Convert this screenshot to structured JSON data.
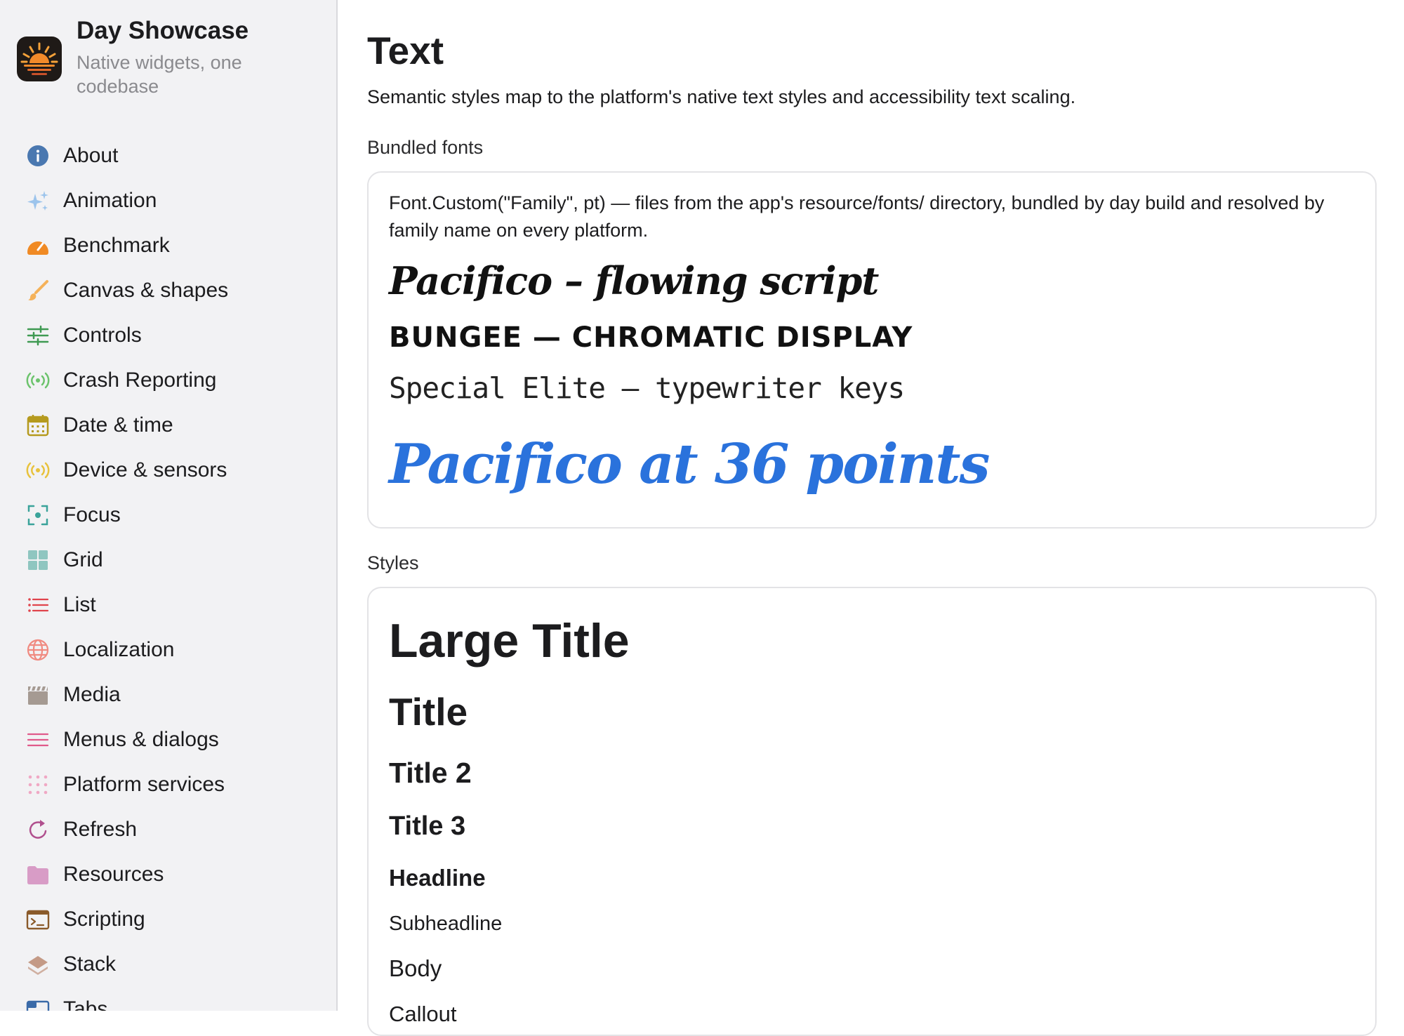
{
  "sidebar": {
    "app_name": "Day Showcase",
    "app_subtitle": "Native widgets, one codebase",
    "items": [
      {
        "label": "About",
        "icon": "info-icon",
        "color": "#4a78b0"
      },
      {
        "label": "Animation",
        "icon": "sparkles-icon",
        "color": "#9cc4ec"
      },
      {
        "label": "Benchmark",
        "icon": "speedometer-icon",
        "color": "#f08a24"
      },
      {
        "label": "Canvas & shapes",
        "icon": "paintbrush-icon",
        "color": "#f5b25a"
      },
      {
        "label": "Controls",
        "icon": "sliders-icon",
        "color": "#3f9a52"
      },
      {
        "label": "Crash Reporting",
        "icon": "broadcast-icon",
        "color": "#6cc36c"
      },
      {
        "label": "Date & time",
        "icon": "calendar-icon",
        "color": "#b59a1e"
      },
      {
        "label": "Device & sensors",
        "icon": "sensor-icon",
        "color": "#e8c23c"
      },
      {
        "label": "Focus",
        "icon": "focus-icon",
        "color": "#3aa39a"
      },
      {
        "label": "Grid",
        "icon": "grid-icon",
        "color": "#8fc6c0"
      },
      {
        "label": "List",
        "icon": "list-icon",
        "color": "#e0444c"
      },
      {
        "label": "Localization",
        "icon": "globe-icon",
        "color": "#f08a80"
      },
      {
        "label": "Media",
        "icon": "clapperboard-icon",
        "color": "#a59a92"
      },
      {
        "label": "Menus & dialogs",
        "icon": "menu-icon",
        "color": "#e05a8a"
      },
      {
        "label": "Platform services",
        "icon": "dots-grid-icon",
        "color": "#f0a8c4"
      },
      {
        "label": "Refresh",
        "icon": "refresh-icon",
        "color": "#b0508e"
      },
      {
        "label": "Resources",
        "icon": "folder-icon",
        "color": "#d89cc6"
      },
      {
        "label": "Scripting",
        "icon": "terminal-icon",
        "color": "#8a5a2a"
      },
      {
        "label": "Stack",
        "icon": "stack-icon",
        "color": "#c49a86"
      },
      {
        "label": "Tabs",
        "icon": "tabs-icon",
        "color": "#3a6aa8"
      }
    ]
  },
  "main": {
    "title": "Text",
    "description": "Semantic styles map to the platform's native text styles and accessibility text scaling.",
    "bundled_fonts": {
      "section_label": "Bundled fonts",
      "note": "Font.Custom(\"Family\", pt) — files from the app's resource/fonts/ directory, bundled by day build and resolved by family name on every platform.",
      "samples": {
        "pacifico": "Pacifico – flowing script",
        "bungee": "BUNGEE — CHROMATIC DISPLAY",
        "special_elite": "Special Elite — typewriter keys",
        "pacifico_large": "Pacifico at 36 points"
      },
      "accent_color": "#2a72dc"
    },
    "styles": {
      "section_label": "Styles",
      "large_title": "Large Title",
      "title": "Title",
      "title2": "Title 2",
      "title3": "Title 3",
      "headline": "Headline",
      "subheadline": "Subheadline",
      "body": "Body",
      "callout": "Callout"
    }
  }
}
